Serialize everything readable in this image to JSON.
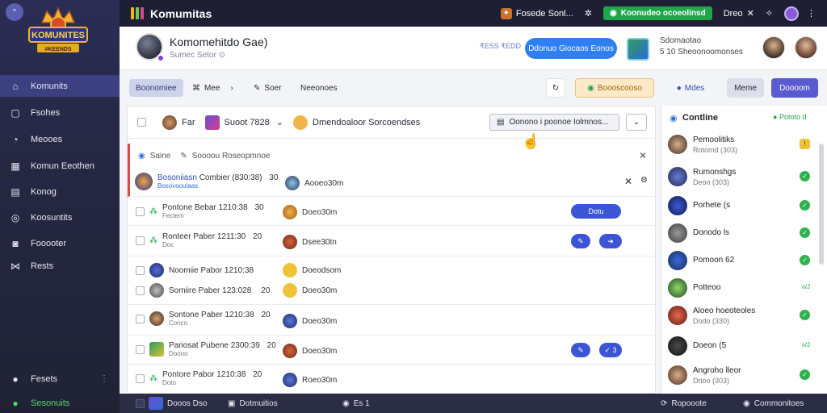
{
  "topbar": {
    "title": "Komumitas",
    "item_1": "Fosede Sonl...",
    "green_label": "Koonudeo ocoeolinsd",
    "item_2": "Dreo",
    "brand_colors": [
      "#f3b321",
      "#6bd047",
      "#d04c8e"
    ]
  },
  "sidebar": {
    "logo_text_1": "KOMUNITES",
    "logo_text_2": "#KEENDS",
    "items": [
      {
        "label": "Komunits",
        "icon": "home-icon"
      },
      {
        "label": "Fsohes",
        "icon": "square-icon"
      },
      {
        "label": "Meooes",
        "icon": "gauge-icon"
      },
      {
        "label": "Komun Eeothen",
        "icon": "grid-icon"
      },
      {
        "label": "Konog",
        "icon": "calendar-icon"
      },
      {
        "label": "Koosuntits",
        "icon": "globe-icon"
      },
      {
        "label": "Fooooter",
        "icon": "gamepad-icon"
      },
      {
        "label": "Rests",
        "icon": "share-icon"
      }
    ],
    "bottom_items": [
      {
        "label": "Fesets",
        "icon": "user-group-icon"
      },
      {
        "label": "Sesonuits",
        "icon": "user-icon"
      }
    ],
    "accent": "#3d4080"
  },
  "header": {
    "channel_title": "Komomehitdo Gae)",
    "channel_sub": "Sumec Setor",
    "light_label": "₹ESS ₹EDD",
    "blue_button": "Ddonuo Giocaos Eonos",
    "stats_line_1": "Sdomaotao",
    "stats_line_2": "5 10 Sheoonoomonses"
  },
  "toolbar": {
    "tabs": [
      "Boonomiee",
      "Mee",
      "Soer",
      "Neeonoes"
    ],
    "orange_btn": "Boooscooso",
    "mute_btn": "Mdes",
    "gray_btn": "Meme",
    "purple_btn": "Doooom"
  },
  "filter": {
    "label_1": "Far",
    "label_2": "Suoot 7828",
    "label_3": "Dmendoaloor Sorcoendses",
    "select_text": "Oonono i poonoe Iolmnos..."
  },
  "notice": {
    "label_1": "Saine",
    "label_2": "Soooou Roseopmnoe"
  },
  "messages": [
    {
      "name": "Bosoniiasn",
      "meta": "Combier (830:38)",
      "num": "30",
      "sub": "Bosovooulaas",
      "title": "Aooeo30m",
      "highlight": true
    },
    {
      "name": "Pontone Bebar 1210:38",
      "num": "30",
      "sub": "Fectem",
      "title": "Doeo30m",
      "action": "Dotu"
    },
    {
      "name": "Ronteer Paber 1211:30",
      "num": "20",
      "sub": "Doc",
      "title": "Dsee30tn",
      "action": "✓ ✓"
    },
    {
      "name": "Noomiie Pabor 1210:38",
      "title": "Doeodsom"
    },
    {
      "name": "Somiire Paber 123:028",
      "num": "20",
      "title": "Doeo30m"
    },
    {
      "name": "Sontone Paber 1210:38",
      "num": "20",
      "sub": "Conco",
      "title": "Doeo30m"
    },
    {
      "name": "Pariosat Pubene 2300:39",
      "num": "20",
      "sub": "Doooo",
      "title": "Doeo30m",
      "action": "✓ 3"
    },
    {
      "name": "Pontore Pabor 1210:38",
      "num": "20",
      "sub": "Doto",
      "title": "Roeo30m"
    }
  ],
  "members_panel": {
    "title": "Contline",
    "online": "Pototo d",
    "members": [
      {
        "name": "Pemoolitiks",
        "sub": "Rotomd (303)",
        "status": "warn"
      },
      {
        "name": "Rumonshgs",
        "sub": "Deon (303)",
        "status": "ok"
      },
      {
        "name": "Porhete (s",
        "sub": "",
        "status": "ok"
      },
      {
        "name": "Donodo ls",
        "sub": "",
        "status": "ok"
      },
      {
        "name": "Pomoon 62",
        "sub": "",
        "status": "ok"
      },
      {
        "name": "Potteoo",
        "sub": "",
        "status": "text"
      },
      {
        "name": "Aloeo hoeoteoles",
        "sub": "Dodo (330)",
        "status": "ok"
      },
      {
        "name": "Doeon (5",
        "sub": "",
        "status": "text"
      },
      {
        "name": "Angroho lleor",
        "sub": "Drioo (303)",
        "status": "ok"
      }
    ]
  },
  "bottombar": {
    "item_1": "Dooos Dso",
    "item_2": "Dotmuitios",
    "item_3": "Es 1",
    "item_4": "Ropooote",
    "item_5": "Commonitoes"
  }
}
